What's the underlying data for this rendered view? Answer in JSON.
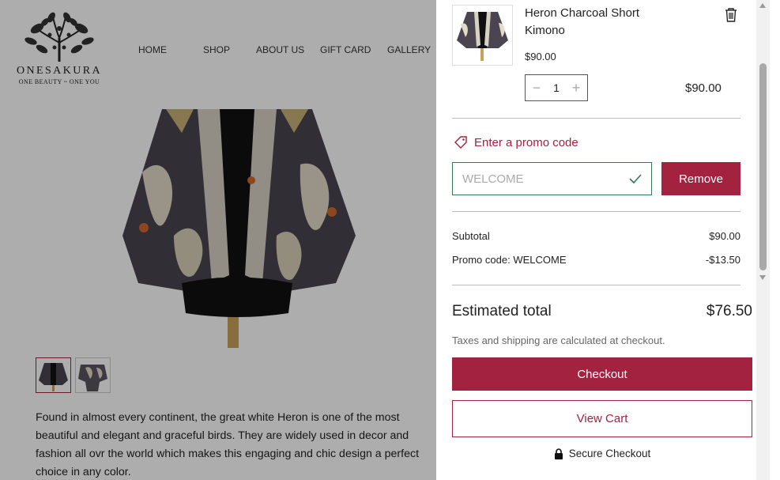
{
  "brand": {
    "name": "ONESAKURA",
    "tagline": "ONE BEAUTY ~ ONE YOU"
  },
  "nav": {
    "items": [
      "HOME",
      "SHOP",
      "ABOUT US",
      "GIFT CARD",
      "GALLERY"
    ]
  },
  "product": {
    "description": "Found in almost every continent, the great white Heron is one of the most beautiful and elegant and graceful birds. They are widely used in decor and fashion all ovr the world which makes this engaging and chic design a perfect choice in any color."
  },
  "cart": {
    "item": {
      "name": "Heron Charcoal Short Kimono",
      "price": "$90.00",
      "quantity": "1",
      "line_total": "$90.00"
    },
    "promo": {
      "link_label": "Enter a promo code",
      "code_value": "WELCOME",
      "remove_label": "Remove"
    },
    "summary": {
      "subtotal_label": "Subtotal",
      "subtotal_value": "$90.00",
      "promo_label": "Promo code: WELCOME",
      "promo_value": "-$13.50",
      "estimated_label": "Estimated total",
      "estimated_value": "$76.50",
      "tax_note": "Taxes and shipping are calculated at checkout."
    },
    "checkout_label": "Checkout",
    "view_cart_label": "View Cart",
    "secure_label": "Secure Checkout"
  },
  "colors": {
    "accent": "#a3223f",
    "promo_border": "#2f7a5a"
  },
  "icons": {
    "trash": "trash-icon",
    "tag": "tag-icon",
    "check": "check-icon",
    "lock": "lock-icon",
    "minus": "minus-icon",
    "plus": "plus-icon"
  }
}
